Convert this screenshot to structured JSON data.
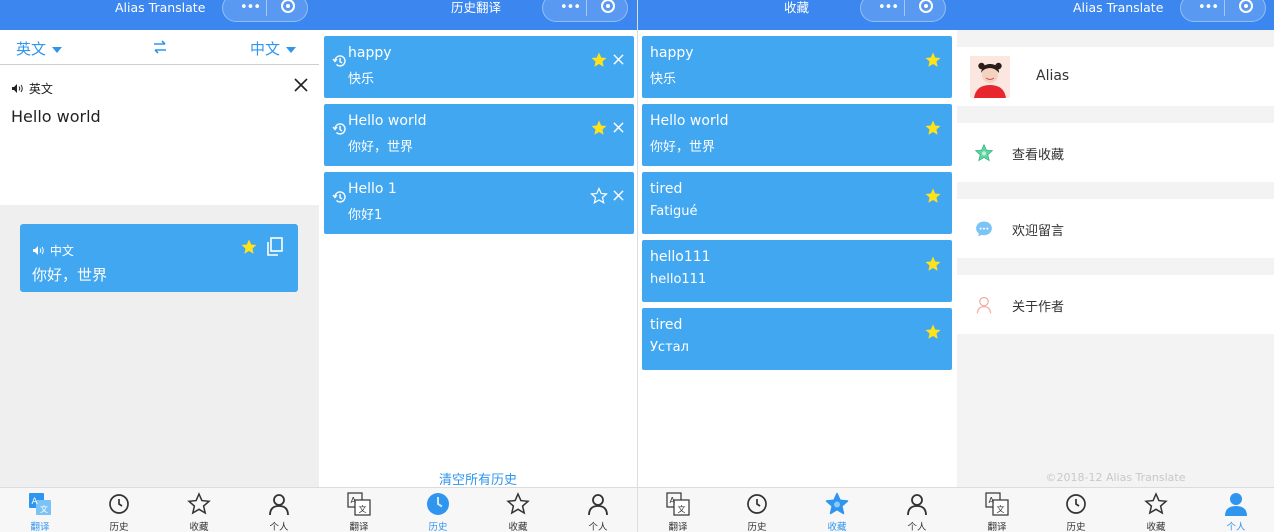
{
  "colors": {
    "accent": "#3b86ef",
    "card": "#42a7f1",
    "link": "#2f95ee",
    "star": "#ffe21a"
  },
  "tabs": [
    {
      "label": "翻译",
      "icon": "translate-icon"
    },
    {
      "label": "历史",
      "icon": "clock-icon"
    },
    {
      "label": "收藏",
      "icon": "star-icon"
    },
    {
      "label": "个人",
      "icon": "person-icon"
    }
  ],
  "translate": {
    "title": "Alias Translate",
    "from_lang": "英文",
    "to_lang": "中文",
    "source_label": "英文",
    "source_text": "Hello world",
    "result_label": "中文",
    "result_text": "你好，世界"
  },
  "history": {
    "title": "历史翻译",
    "items": [
      {
        "word": "happy",
        "translation": "快乐",
        "starred": true
      },
      {
        "word": "Hello world",
        "translation": "你好，世界",
        "starred": true
      },
      {
        "word": "Hello 1",
        "translation": "你好1",
        "starred": false
      }
    ],
    "clear_label": "清空所有历史"
  },
  "favorites": {
    "title": "收藏",
    "items": [
      {
        "word": "happy",
        "translation": "快乐"
      },
      {
        "word": "Hello world",
        "translation": "你好，世界"
      },
      {
        "word": "tired",
        "translation": "Fatigué"
      },
      {
        "word": "hello111",
        "translation": "hello111"
      },
      {
        "word": "tired",
        "translation": "Устал"
      }
    ]
  },
  "profile": {
    "title": "Alias Translate",
    "username": "Alias",
    "menu": [
      {
        "label": "查看收藏",
        "icon": "star-outline-icon"
      },
      {
        "label": "欢迎留言",
        "icon": "message-icon"
      },
      {
        "label": "关于作者",
        "icon": "author-icon"
      }
    ],
    "footer": "©2018-12 Alias Translate"
  }
}
